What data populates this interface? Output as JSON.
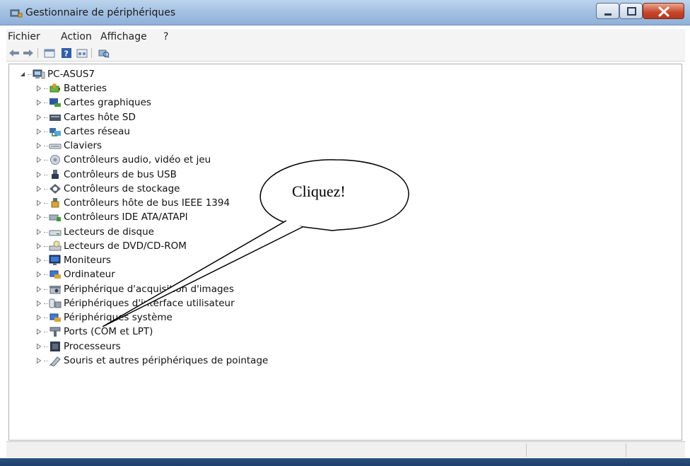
{
  "window": {
    "title": "Gestionnaire de périphériques",
    "background_ghost_texts": [],
    "controls": {
      "minimize": "minimize",
      "maximize": "maximize",
      "close": "close"
    }
  },
  "menu": {
    "items": [
      "Fichier",
      "Action",
      "Affichage",
      "?"
    ]
  },
  "toolbar": {
    "buttons": [
      "back-arrow-icon",
      "forward-arrow-icon",
      "properties-icon",
      "help-icon",
      "view-icon",
      "scan-hardware-icon"
    ]
  },
  "tree": {
    "root": {
      "label": "PC-ASUS7",
      "expanded": true,
      "icon": "computer-icon"
    },
    "children": [
      {
        "label": "Batteries",
        "icon": "battery-icon"
      },
      {
        "label": "Cartes graphiques",
        "icon": "display-adapter-icon"
      },
      {
        "label": "Cartes hôte SD",
        "icon": "sd-host-icon"
      },
      {
        "label": "Cartes réseau",
        "icon": "network-adapter-icon"
      },
      {
        "label": "Claviers",
        "icon": "keyboard-icon"
      },
      {
        "label": "Contrôleurs audio, vidéo et jeu",
        "icon": "audio-icon"
      },
      {
        "label": "Contrôleurs de bus USB",
        "icon": "usb-icon"
      },
      {
        "label": "Contrôleurs de stockage",
        "icon": "storage-controller-icon"
      },
      {
        "label": "Contrôleurs hôte de bus IEEE 1394",
        "icon": "ieee1394-icon"
      },
      {
        "label": "Contrôleurs IDE ATA/ATAPI",
        "icon": "ide-icon"
      },
      {
        "label": "Lecteurs de disque",
        "icon": "disk-drive-icon"
      },
      {
        "label": "Lecteurs de DVD/CD-ROM",
        "icon": "dvd-drive-icon"
      },
      {
        "label": "Moniteurs",
        "icon": "monitor-icon"
      },
      {
        "label": "Ordinateur",
        "icon": "computer-small-icon"
      },
      {
        "label": "Périphérique d'acquisition d'images",
        "icon": "imaging-device-icon"
      },
      {
        "label": "Périphériques d'interface utilisateur",
        "icon": "hid-icon"
      },
      {
        "label": "Périphériques système",
        "icon": "system-device-icon"
      },
      {
        "label": "Ports (COM et LPT)",
        "icon": "port-icon"
      },
      {
        "label": "Processeurs",
        "icon": "processor-icon"
      },
      {
        "label": "Souris et autres périphériques de pointage",
        "icon": "mouse-icon"
      }
    ]
  },
  "annotation": {
    "callout_text": "Cliquez!",
    "points_to": "Ports (COM et LPT)"
  },
  "colors": {
    "titlebar": "#a5c2e3",
    "close_button": "#c6452b",
    "tree_background": "#ffffff"
  }
}
